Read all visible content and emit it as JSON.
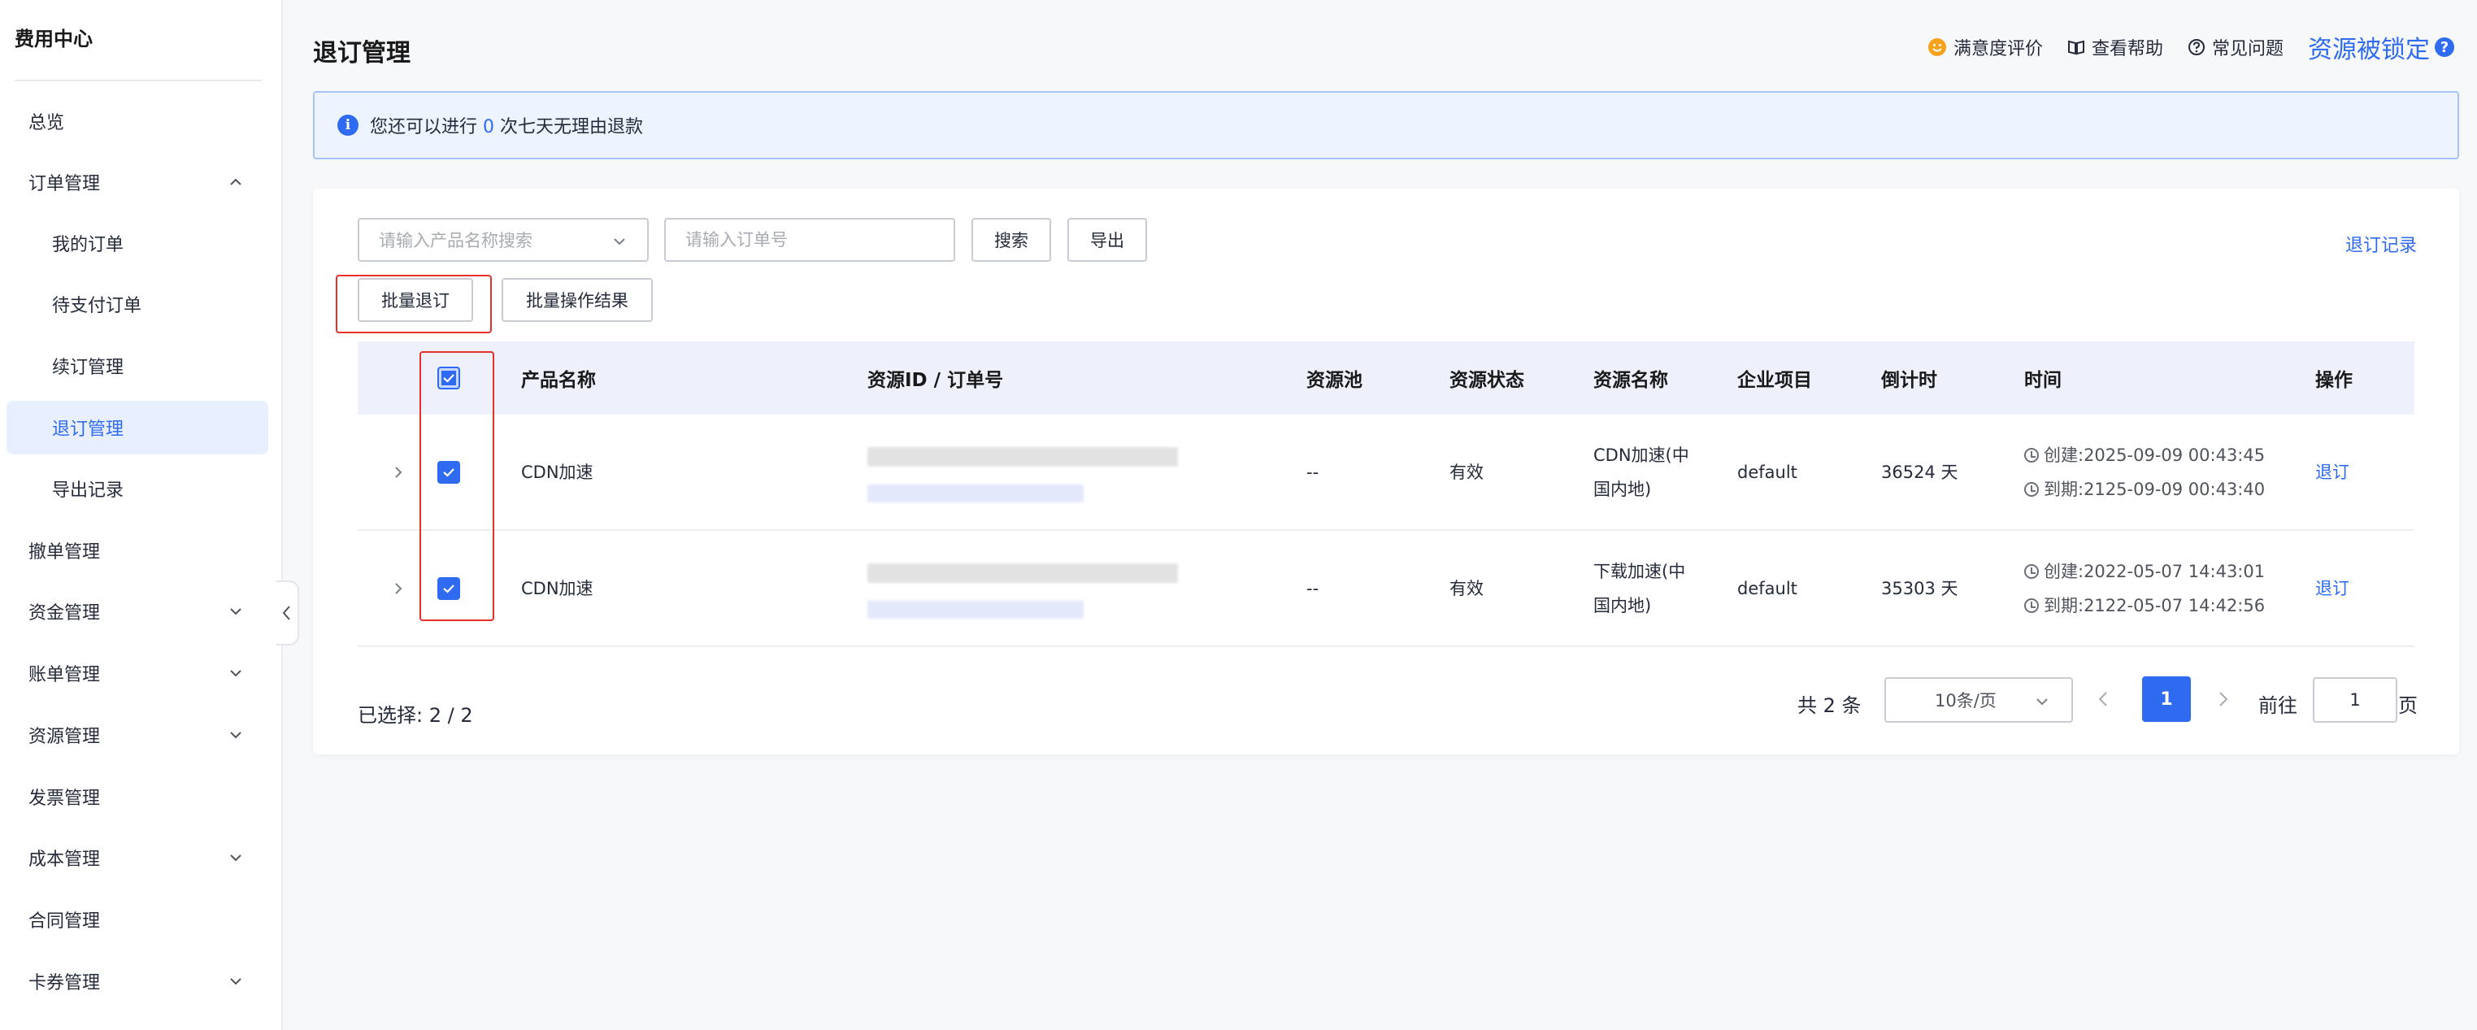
{
  "sidebar": {
    "title": "费用中心",
    "items": [
      {
        "label": "总览"
      },
      {
        "label": "订单管理"
      },
      {
        "label": "我的订单"
      },
      {
        "label": "待支付订单"
      },
      {
        "label": "续订管理"
      },
      {
        "label": "退订管理"
      },
      {
        "label": "导出记录"
      },
      {
        "label": "撤单管理"
      },
      {
        "label": "资金管理"
      },
      {
        "label": "账单管理"
      },
      {
        "label": "资源管理"
      },
      {
        "label": "发票管理"
      },
      {
        "label": "成本管理"
      },
      {
        "label": "合同管理"
      },
      {
        "label": "卡券管理"
      }
    ]
  },
  "header": {
    "title": "退订管理",
    "links": {
      "satisfaction": "满意度评价",
      "help": "查看帮助",
      "faq": "常见问题",
      "locked": "资源被锁定"
    }
  },
  "notice": {
    "prefix": "您还可以进行",
    "count": "0",
    "suffix": "次七天无理由退款"
  },
  "toolbar": {
    "product_placeholder": "请输入产品名称搜索",
    "order_placeholder": "请输入订单号",
    "search": "搜索",
    "export": "导出",
    "record": "退订记录",
    "batch_unsubscribe": "批量退订",
    "batch_result": "批量操作结果"
  },
  "table": {
    "headers": {
      "product": "产品名称",
      "resource_id": "资源ID / 订单号",
      "pool": "资源池",
      "status": "资源状态",
      "name": "资源名称",
      "project": "企业项目",
      "countdown": "倒计时",
      "time": "时间",
      "action": "操作"
    },
    "rows": [
      {
        "product": "CDN加速",
        "pool": "--",
        "status": "有效",
        "name_line1": "CDN加速(中",
        "name_line2": "国内地)",
        "project": "default",
        "countdown": "36524 天",
        "created": "创建:2025-09-09 00:43:45",
        "expires": "到期:2125-09-09 00:43:40",
        "action": "退订"
      },
      {
        "product": "CDN加速",
        "pool": "--",
        "status": "有效",
        "name_line1": "下载加速(中",
        "name_line2": "国内地)",
        "project": "default",
        "countdown": "35303 天",
        "created": "创建:2022-05-07 14:43:01",
        "expires": "到期:2122-05-07 14:42:56",
        "action": "退订"
      }
    ]
  },
  "footer": {
    "selected": "已选择: 2 / 2",
    "total": "共 2 条",
    "page_size": "10条/页",
    "current_page": "1",
    "goto_label": "前往",
    "goto_value": "1",
    "page_unit": "页"
  },
  "colors": {
    "accent": "#2f6bf1",
    "highlight_border": "#e5312a",
    "notice_bg": "#eef4ff",
    "header_bg": "#eef1fb"
  },
  "icons": {
    "chevron": "chevron-icon",
    "info": "info-icon",
    "smile": "smile-icon",
    "book": "book-icon",
    "question": "question-icon",
    "clock": "clock-icon",
    "check": "check-icon"
  }
}
